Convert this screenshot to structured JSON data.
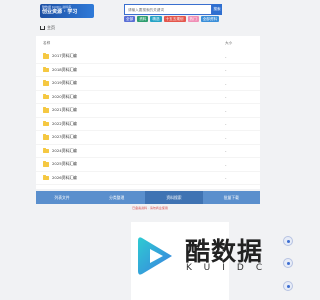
{
  "header": {
    "logo_small": "酷数据 KUIDC 资料库",
    "logo_big": "创业资源 · 学习",
    "search_placeholder": "请输入要搜索的关键词",
    "search_button": "搜索"
  },
  "tags": [
    {
      "label": "全部",
      "color": "#5a6fd6"
    },
    {
      "label": "资料",
      "color": "#2e9e6f"
    },
    {
      "label": "精选",
      "color": "#27a4c6"
    },
    {
      "label": "十五五规划",
      "color": "#e4564c"
    },
    {
      "label": "热门",
      "color": "#f08fb6"
    },
    {
      "label": "全部资料",
      "color": "#3b8fd9"
    }
  ],
  "breadcrumb": {
    "label": "主页"
  },
  "file_list": {
    "headers": {
      "name": "名称",
      "size": "大小"
    },
    "rows": [
      {
        "name": "2017资料汇编",
        "size": "-"
      },
      {
        "name": "2018资料汇编",
        "size": "-"
      },
      {
        "name": "2019资料汇编",
        "size": "-"
      },
      {
        "name": "2020资料汇编",
        "size": "-"
      },
      {
        "name": "2021资料汇编",
        "size": "-"
      },
      {
        "name": "2022资料汇编",
        "size": "-"
      },
      {
        "name": "2023资料汇编",
        "size": "-"
      },
      {
        "name": "2024资料汇编",
        "size": "-"
      },
      {
        "name": "2025资料汇编",
        "size": "-"
      },
      {
        "name": "2026资料汇编",
        "size": "-"
      }
    ]
  },
  "nav": {
    "items": [
      "列表文件",
      "分类整理",
      "资料搜索",
      "批量下载"
    ]
  },
  "footer": {
    "notice": "已备案资料 · 请勿商业使用"
  },
  "brand": {
    "cn": "酷数据",
    "en": "KUIDC"
  }
}
